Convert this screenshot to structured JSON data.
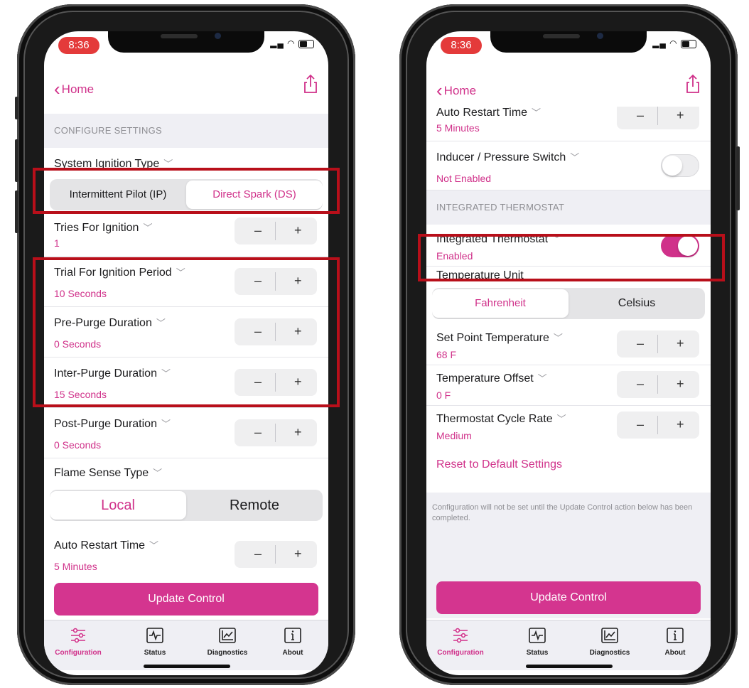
{
  "colors": {
    "accent": "#d0318a",
    "highlight": "#b80f1a",
    "time_pill": "#e43a3a"
  },
  "left": {
    "status_time": "8:36",
    "nav": {
      "back_label": "Home",
      "share_icon": "share-icon"
    },
    "section_title": "CONFIGURE SETTINGS",
    "ignition": {
      "label": "System Ignition Type",
      "options": [
        "Intermittent Pilot (IP)",
        "Direct Spark (DS)"
      ],
      "selected": "Direct Spark (DS)"
    },
    "rows": [
      {
        "label": "Tries For Ignition",
        "value": "1"
      },
      {
        "label": "Trial For Ignition Period",
        "value": "10 Seconds"
      },
      {
        "label": "Pre-Purge Duration",
        "value": "0 Seconds"
      },
      {
        "label": "Inter-Purge Duration",
        "value": "15 Seconds"
      },
      {
        "label": "Post-Purge Duration",
        "value": "0 Seconds"
      }
    ],
    "flame": {
      "label": "Flame Sense Type",
      "options": [
        "Local",
        "Remote"
      ],
      "selected": "Local"
    },
    "auto_restart": {
      "label": "Auto Restart Time",
      "value": "5 Minutes"
    },
    "stepper": {
      "minus": "–",
      "plus": "+"
    },
    "update_button": "Update Control"
  },
  "right": {
    "status_time": "8:36",
    "nav": {
      "back_label": "Home"
    },
    "auto_restart_partial": {
      "label": "Auto Restart Time",
      "value": "5 Minutes"
    },
    "inducer": {
      "label": "Inducer / Pressure Switch",
      "value": "Not Enabled",
      "enabled": false
    },
    "section_title": "INTEGRATED THERMOSTAT",
    "thermostat": {
      "label": "Integrated Thermostat",
      "value": "Enabled",
      "enabled": true
    },
    "temp_unit": {
      "label": "Temperature Unit",
      "options": [
        "Fahrenheit",
        "Celsius"
      ],
      "selected": "Fahrenheit"
    },
    "rows": [
      {
        "label": "Set Point Temperature",
        "value": "68 F"
      },
      {
        "label": "Temperature Offset",
        "value": "0 F"
      },
      {
        "label": "Thermostat Cycle Rate",
        "value": "Medium"
      }
    ],
    "reset_link": "Reset to Default Settings",
    "note": "Configuration will not be set until the Update Control action below has been completed.",
    "update_button": "Update Control"
  },
  "tabbar": {
    "tabs": [
      {
        "label": "Configuration",
        "icon": "sliders-icon",
        "active": true
      },
      {
        "label": "Status",
        "icon": "pulse-icon",
        "active": false
      },
      {
        "label": "Diagnostics",
        "icon": "chart-icon",
        "active": false
      },
      {
        "label": "About",
        "icon": "info-icon",
        "active": false
      }
    ]
  }
}
